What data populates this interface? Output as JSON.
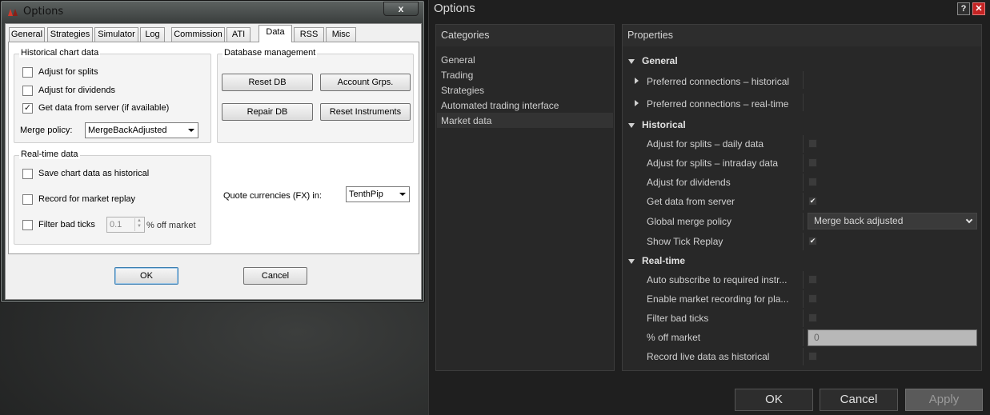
{
  "old_window": {
    "title": "Options",
    "close_glyph": "x",
    "tabs": [
      "General",
      "Strategies",
      "Simulator",
      "Log",
      "Commission",
      "ATI",
      "Data",
      "RSS",
      "Misc"
    ],
    "active_tab": "Data",
    "historical_group": {
      "title": "Historical chart data",
      "checkboxes": [
        {
          "label": "Adjust for splits",
          "checked": false
        },
        {
          "label": "Adjust for dividends",
          "checked": false
        },
        {
          "label": "Get data from server (if available)",
          "checked": true
        }
      ],
      "merge_label": "Merge policy:",
      "merge_value": "MergeBackAdjusted"
    },
    "database_group": {
      "title": "Database management",
      "buttons": [
        "Reset DB",
        "Account Grps.",
        "Repair DB",
        "Reset Instruments"
      ]
    },
    "realtime_group": {
      "title": "Real-time data",
      "checkboxes": [
        {
          "label": "Save chart data as historical",
          "checked": false
        },
        {
          "label": "Record for market replay",
          "checked": false
        },
        {
          "label": "Filter bad ticks",
          "checked": false
        }
      ],
      "offmarket_value": "0.1",
      "offmarket_suffix": "% off market"
    },
    "quote_label": "Quote currencies (FX) in:",
    "quote_value": "TenthPip",
    "ok_label": "OK",
    "cancel_label": "Cancel"
  },
  "new_window": {
    "title": "Options",
    "help_glyph": "?",
    "close_glyph": "✕",
    "categories_header": "Categories",
    "categories": [
      "General",
      "Trading",
      "Strategies",
      "Automated trading interface",
      "Market data"
    ],
    "selected_category": "Market data",
    "properties_header": "Properties",
    "sections": {
      "general": {
        "title": "General",
        "rows": [
          "Preferred connections – historical",
          "Preferred connections – real-time"
        ]
      },
      "historical": {
        "title": "Historical",
        "rows": [
          {
            "label": "Adjust for splits – daily data",
            "checked": false
          },
          {
            "label": "Adjust for splits – intraday data",
            "checked": false
          },
          {
            "label": "Adjust for dividends",
            "checked": false
          },
          {
            "label": "Get data from server",
            "checked": true
          }
        ],
        "merge_label": "Global merge policy",
        "merge_value": "Merge back adjusted",
        "tick_replay_label": "Show Tick Replay",
        "tick_replay_checked": true
      },
      "realtime": {
        "title": "Real-time",
        "rows": [
          {
            "label": "Auto subscribe to required instr...",
            "checked": false
          },
          {
            "label": "Enable market recording for pla...",
            "checked": false
          },
          {
            "label": "Filter bad ticks",
            "checked": false
          }
        ],
        "offmarket_label": "% off market",
        "offmarket_value": "0",
        "record_live_label": "Record live data as historical",
        "record_live_checked": false
      }
    },
    "ok_label": "OK",
    "cancel_label": "Cancel",
    "apply_label": "Apply"
  },
  "colors": {
    "dark_bg": "#1f1f1f",
    "dark_panel": "#282828",
    "close_red": "#c42323",
    "classic_face": "#f0f0f0"
  }
}
